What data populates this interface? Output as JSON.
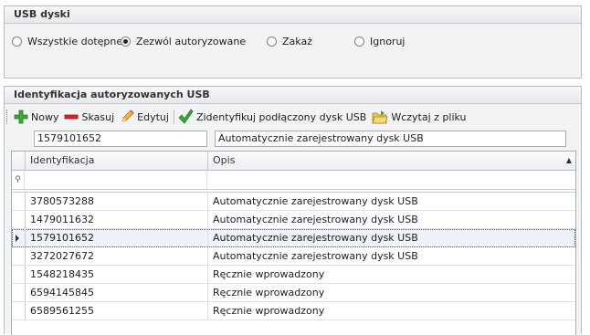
{
  "usb_panel": {
    "title": "USB dyski",
    "options": [
      {
        "label": "Wszystkie dotępne",
        "checked": false
      },
      {
        "label": "Zezwól autoryzowane",
        "checked": true
      },
      {
        "label": "Zakaż",
        "checked": false
      },
      {
        "label": "Ignoruj",
        "checked": false
      }
    ]
  },
  "id_panel": {
    "title": "Identyfikacja autoryzowanych USB",
    "toolbar": {
      "new": "Nowy",
      "delete": "Skasuj",
      "edit": "Edytuj",
      "identify": "Zidentyfikuj podłączony dysk USB",
      "load": "Wczytaj z pliku"
    },
    "edit_id_value": "1579101652",
    "edit_desc_value": "Automatycznie zarejestrowany dysk USB",
    "columns": [
      "Identyfikacja",
      "Opis"
    ],
    "rows": [
      {
        "id": "3780573288",
        "desc": "Automatycznie zarejestrowany dysk USB"
      },
      {
        "id": "1479011632",
        "desc": "Automatycznie zarejestrowany dysk USB"
      },
      {
        "id": "1579101652",
        "desc": "Automatycznie zarejestrowany dysk USB"
      },
      {
        "id": "3272027672",
        "desc": "Automatycznie zarejestrowany dysk USB"
      },
      {
        "id": "1548218435",
        "desc": "Ręcznie wprowadzony"
      },
      {
        "id": "6594145845",
        "desc": "Ręcznie wprowadzony"
      },
      {
        "id": "6589561255",
        "desc": "Ręcznie wprowadzony"
      }
    ],
    "selected_row": 2
  }
}
